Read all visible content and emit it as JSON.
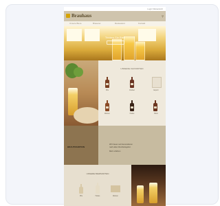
{
  "site": {
    "logo": "Brauhaus",
    "hero_title": "Trinken Sie Bier",
    "nav": [
      {
        "label": "Unsere Biere"
      },
      {
        "label": "Brauerei"
      },
      {
        "label": "Restaurant"
      },
      {
        "label": "Kontakt"
      }
    ],
    "favorites": {
      "title": "UNSERE FAVORITEN",
      "products": [
        {
          "name": "Pils",
          "color": "#7a3f22"
        },
        {
          "name": "Dunkel",
          "color": "#6a3422"
        },
        {
          "name": "Export",
          "color": "#e8e0d0"
        },
        {
          "name": "Weizen",
          "color": "#8a4a26"
        },
        {
          "name": "Helles",
          "color": "#3a2418"
        },
        {
          "name": "Bock",
          "color": "#6b3620"
        }
      ]
    },
    "band": {
      "heading": "BRAUTRADITION",
      "lines": [
        "Wir brauen seit Generationen",
        "nach altem Reinheitsgebot.",
        "Mehr erfahren"
      ]
    },
    "section3": {
      "title": "UNSERE BIERSORTEN",
      "products": [
        {
          "name": "Pils"
        },
        {
          "name": "Helles"
        },
        {
          "name": "Weizen"
        }
      ]
    },
    "topbar_links": "Login  Warenkorb"
  },
  "colors": {
    "header": "#cfc4ad",
    "band_dark": "#8d7450",
    "logo_mark": "#d6a300"
  }
}
